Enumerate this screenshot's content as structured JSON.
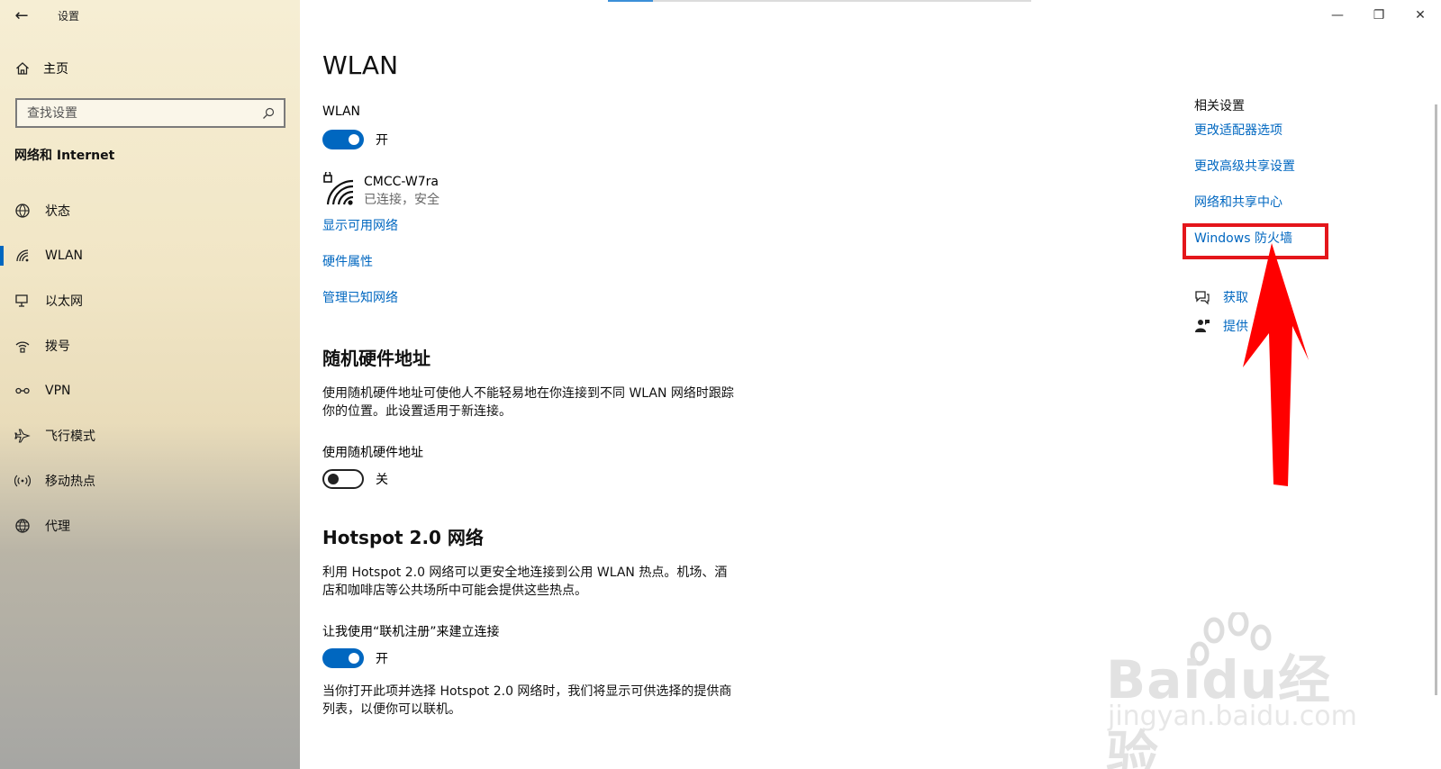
{
  "window": {
    "title": "设置",
    "back": "←",
    "controls": {
      "minimize": "—",
      "restore": "❐",
      "close": "✕"
    }
  },
  "sidebar": {
    "home_label": "主页",
    "search_placeholder": "查找设置",
    "section_title": "网络和 Internet",
    "items": [
      {
        "label": "状态",
        "icon": "globe-status-icon",
        "active": false
      },
      {
        "label": "WLAN",
        "icon": "wifi-icon",
        "active": true
      },
      {
        "label": "以太网",
        "icon": "ethernet-icon",
        "active": false
      },
      {
        "label": "拨号",
        "icon": "dialup-icon",
        "active": false
      },
      {
        "label": "VPN",
        "icon": "vpn-icon",
        "active": false
      },
      {
        "label": "飞行模式",
        "icon": "airplane-icon",
        "active": false
      },
      {
        "label": "移动热点",
        "icon": "hotspot-icon",
        "active": false
      },
      {
        "label": "代理",
        "icon": "globe-icon",
        "active": false
      }
    ]
  },
  "main": {
    "title": "WLAN",
    "wlan_label": "WLAN",
    "wlan_toggle": {
      "state": "on",
      "text": "开"
    },
    "network": {
      "name": "CMCC-W7ra",
      "status": "已连接，安全"
    },
    "links": [
      "显示可用网络",
      "硬件属性",
      "管理已知网络"
    ],
    "random_hw": {
      "heading": "随机硬件地址",
      "description": "使用随机硬件地址可使他人不能轻易地在你连接到不同 WLAN 网络时跟踪你的位置。此设置适用于新连接。",
      "toggle_label": "使用随机硬件地址",
      "toggle": {
        "state": "off",
        "text": "关"
      }
    },
    "hotspot": {
      "heading": "Hotspot 2.0 网络",
      "description": "利用 Hotspot 2.0 网络可以更安全地连接到公用 WLAN 热点。机场、酒店和咖啡店等公共场所中可能会提供这些热点。",
      "toggle_label": "让我使用“联机注册”来建立连接",
      "toggle": {
        "state": "on",
        "text": "开"
      },
      "footer": "当你打开此项并选择 Hotspot 2.0 网络时，我们将显示可供选择的提供商列表，以便你可以联机。"
    }
  },
  "related": {
    "title": "相关设置",
    "links": [
      "更改适配器选项",
      "更改高级共享设置",
      "网络和共享中心",
      "Windows 防火墙"
    ],
    "help": [
      {
        "label": "获取",
        "icon": "help-chat-icon"
      },
      {
        "label": "提供",
        "icon": "feedback-icon"
      }
    ]
  },
  "annotation": {
    "box_color": "#e4161b",
    "arrow_color": "#ff0000"
  },
  "watermark": {
    "text": "Baidu经验",
    "sub": "jingyan.baidu.com"
  },
  "colors": {
    "accent": "#0067c0"
  }
}
